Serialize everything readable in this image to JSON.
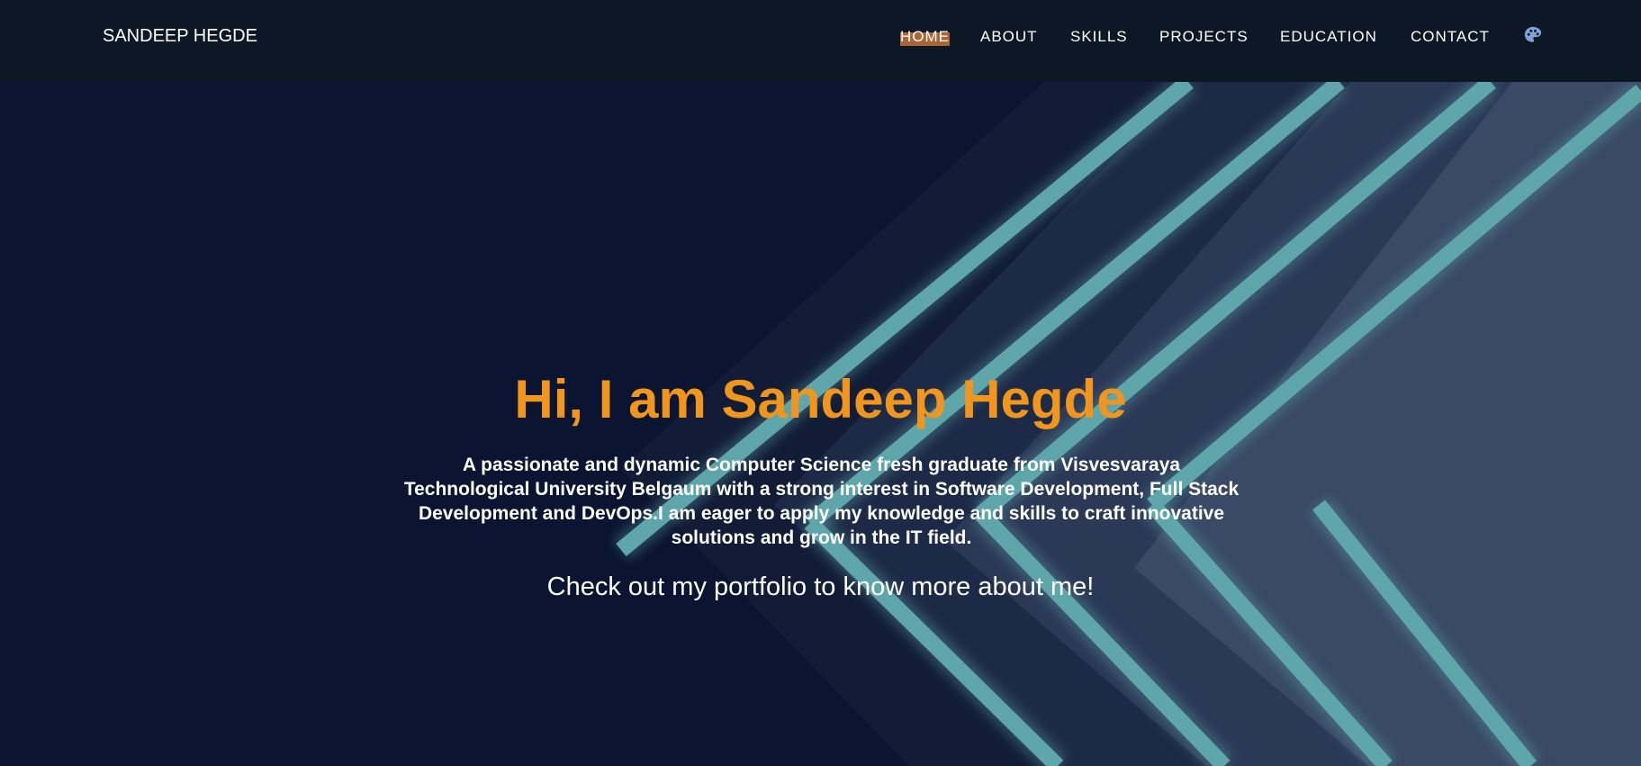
{
  "nav": {
    "brand": "SANDEEP HEGDE",
    "items": [
      {
        "label": "HOME",
        "active": true
      },
      {
        "label": "ABOUT",
        "active": false
      },
      {
        "label": "SKILLS",
        "active": false
      },
      {
        "label": "PROJECTS",
        "active": false
      },
      {
        "label": "EDUCATION",
        "active": false
      },
      {
        "label": "CONTACT",
        "active": false
      }
    ],
    "theme_icon": "palette-icon"
  },
  "hero": {
    "title": "Hi, I am Sandeep Hegde",
    "description": "A passionate and dynamic Computer Science fresh graduate from Visvesvaraya Technological University Belgaum with a strong interest in Software Development, Full Stack Development and DevOps.I am eager to apply my knowledge and skills to craft innovative solutions and grow in the IT field.",
    "cta": "Check out my portfolio to know more about me!"
  },
  "colors": {
    "nav_bg": "#0d1826",
    "hero_bg": "#0b1430",
    "accent": "#f0961e",
    "active_underline": "#cd783c",
    "stripe": "#5fa6aa",
    "icon": "#7fa3d6"
  }
}
